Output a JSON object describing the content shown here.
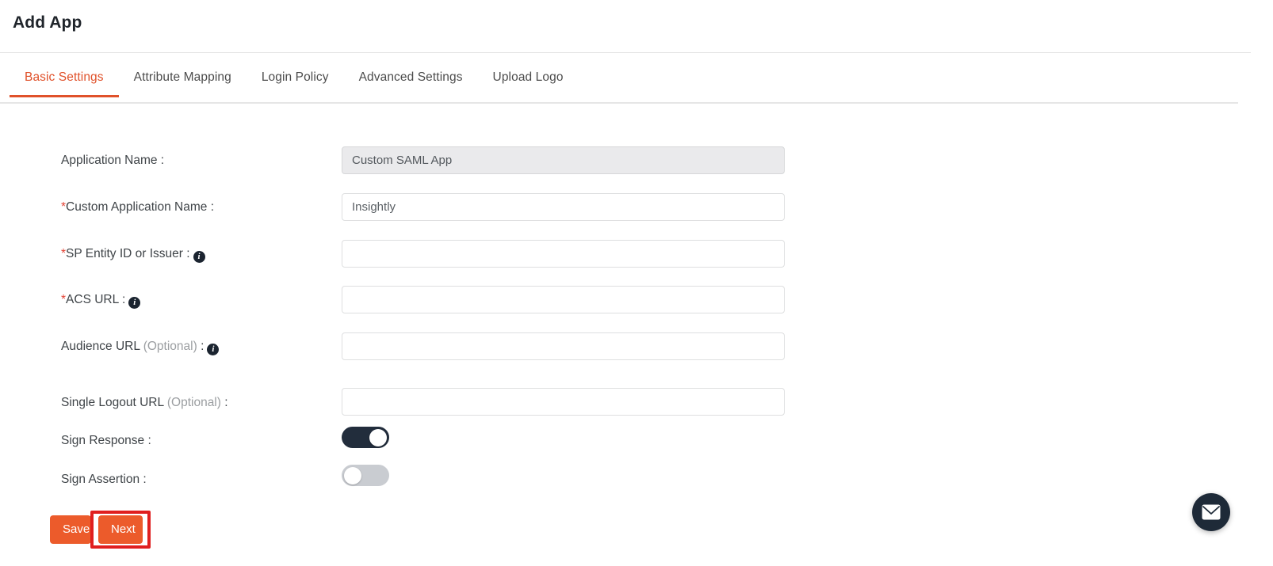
{
  "header": {
    "title": "Add App"
  },
  "tabs": {
    "active_index": 0,
    "items": [
      {
        "label": "Basic Settings"
      },
      {
        "label": "Attribute Mapping"
      },
      {
        "label": "Login Policy"
      },
      {
        "label": "Advanced Settings"
      },
      {
        "label": "Upload Logo"
      }
    ]
  },
  "form": {
    "fields": [
      {
        "label": "Application Name",
        "required": false,
        "optional": false,
        "info": false,
        "value": "Custom SAML App",
        "placeholder": "",
        "readonly": true,
        "type": "text"
      },
      {
        "label": "Custom Application Name",
        "required": true,
        "optional": false,
        "info": false,
        "value": "Insightly",
        "placeholder": "",
        "readonly": false,
        "type": "text"
      },
      {
        "label": "SP Entity ID or Issuer",
        "required": true,
        "optional": false,
        "info": true,
        "value": "",
        "placeholder": "",
        "readonly": false,
        "type": "text"
      },
      {
        "label": "ACS URL",
        "required": true,
        "optional": false,
        "info": true,
        "value": "",
        "placeholder": "",
        "readonly": false,
        "type": "text"
      },
      {
        "label": "Audience URL",
        "required": false,
        "optional": true,
        "info": true,
        "value": "",
        "placeholder": "",
        "readonly": false,
        "type": "text"
      },
      {
        "label": "Single Logout URL",
        "required": false,
        "optional": true,
        "info": false,
        "value": "",
        "placeholder": "",
        "readonly": false,
        "type": "text"
      },
      {
        "label": "Sign Response",
        "required": false,
        "optional": false,
        "info": false,
        "state": "on",
        "type": "toggle"
      },
      {
        "label": "Sign Assertion",
        "required": false,
        "optional": false,
        "info": false,
        "state": "off",
        "type": "toggle"
      }
    ],
    "optional_text": "(Optional)",
    "colon": ":",
    "required_marker": "*"
  },
  "actions": {
    "save_label": "Save",
    "next_label": "Next"
  },
  "fab": {
    "icon": "envelope-icon"
  },
  "colors": {
    "accent": "#e0512a",
    "button": "#ec5b2b",
    "highlight": "#e01f1f",
    "toggle_on": "#222d3c",
    "toggle_off": "#c9ccd1",
    "required": "#e34234",
    "fab": "#1e2a38"
  }
}
